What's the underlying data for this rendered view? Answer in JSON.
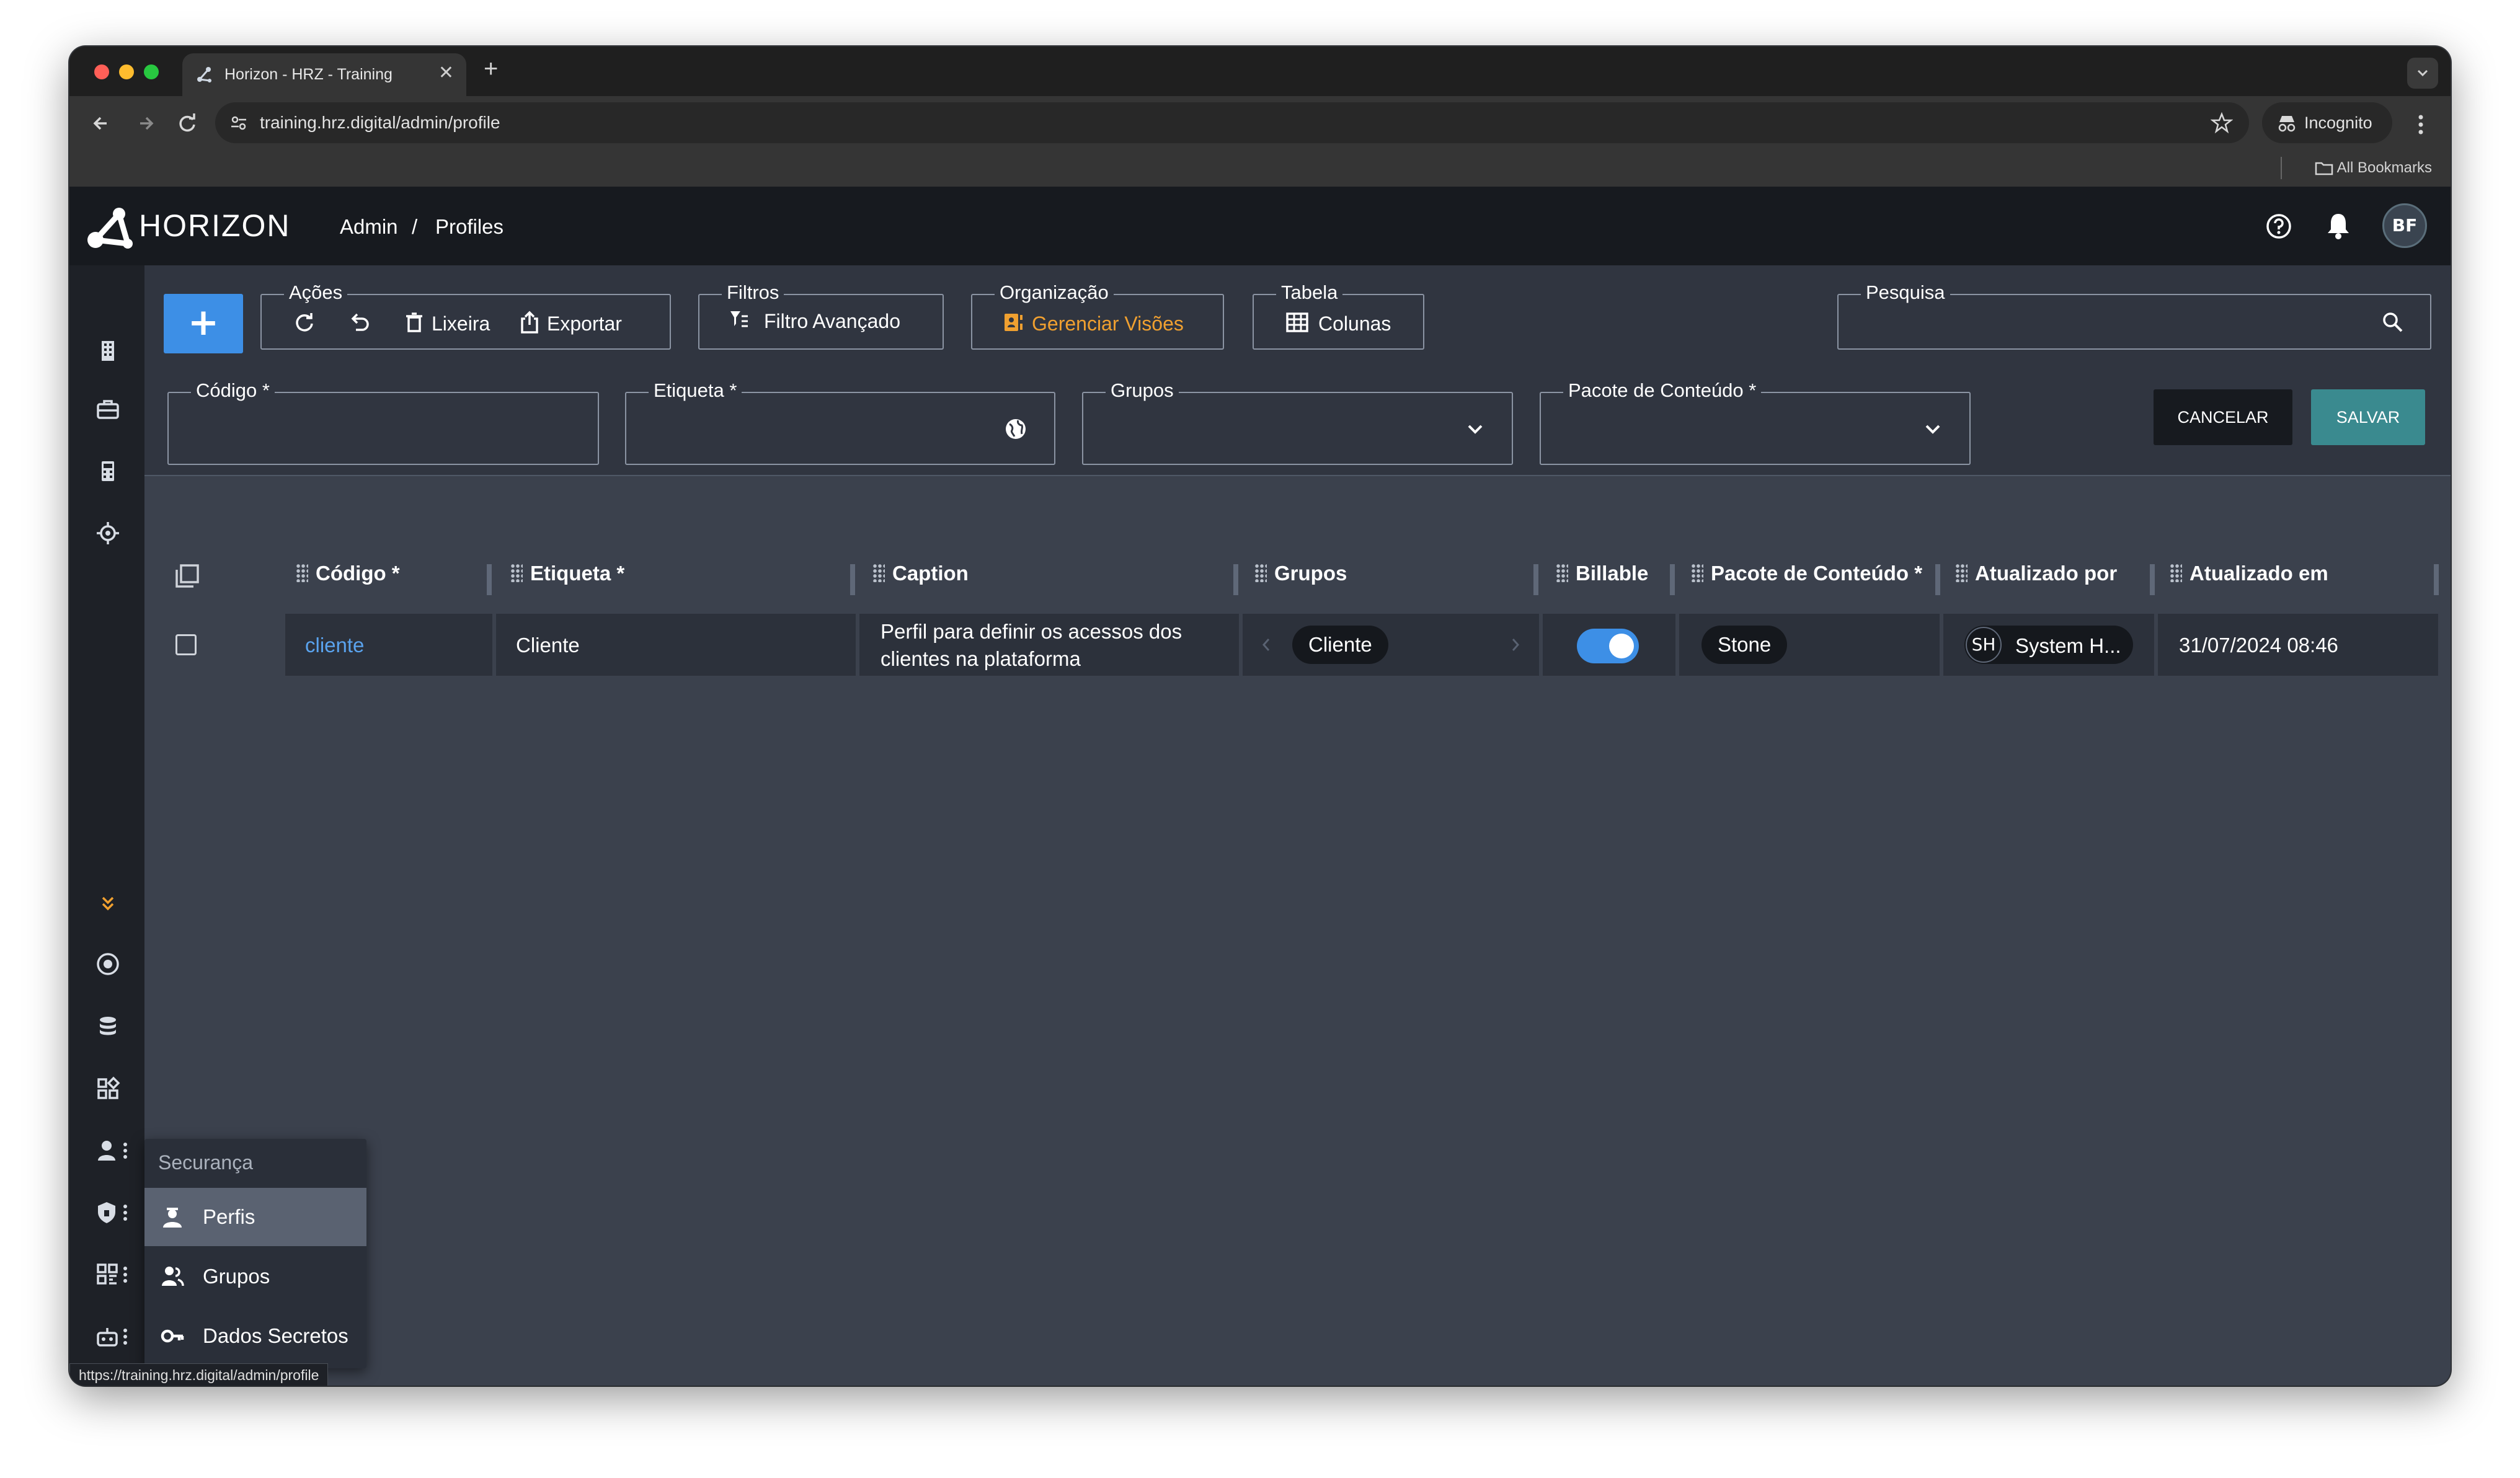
{
  "browser": {
    "tab_title": "Horizon - HRZ - Training",
    "tab_close": "✕",
    "new_tab": "+",
    "url": "training.hrz.digital/admin/profile",
    "incognito_label": "Incognito",
    "bookmarks_label": "All Bookmarks",
    "status_url": "https://training.hrz.digital/admin/profile"
  },
  "header": {
    "brand": "HORIZON",
    "breadcrumb": [
      "Admin",
      "/",
      "Profiles"
    ],
    "avatar_initials": "BF"
  },
  "toolbar": {
    "add_label": "+",
    "acoes": {
      "label": "Ações",
      "lixeira": "Lixeira",
      "exportar": "Exportar"
    },
    "filtros": {
      "label": "Filtros",
      "filtro_avancado": "Filtro Avançado"
    },
    "organizacao": {
      "label": "Organização",
      "gerenciar_visoes": "Gerenciar Visões"
    },
    "tabela": {
      "label": "Tabela",
      "colunas": "Colunas"
    },
    "pesquisa": {
      "label": "Pesquisa",
      "value": ""
    }
  },
  "form": {
    "codigo": {
      "label": "Código *",
      "value": ""
    },
    "etiqueta": {
      "label": "Etiqueta *",
      "value": ""
    },
    "grupos": {
      "label": "Grupos",
      "value": ""
    },
    "pacote": {
      "label": "Pacote de Conteúdo *",
      "value": ""
    },
    "cancel": "CANCELAR",
    "save": "SALVAR"
  },
  "table": {
    "columns": [
      "Código *",
      "Etiqueta *",
      "Caption",
      "Grupos",
      "Billable",
      "Pacote de Conteúdo *",
      "Atualizado por",
      "Atualizado em"
    ],
    "rows": [
      {
        "codigo": "cliente",
        "etiqueta": "Cliente",
        "caption_line1": "Perfil para definir os acessos dos",
        "caption_line2": "clientes na plataforma",
        "grupos": "Cliente",
        "billable": true,
        "pacote": "Stone",
        "atualizado_por_initials": "SH",
        "atualizado_por": "System H...",
        "atualizado_em": "31/07/2024 08:46"
      }
    ]
  },
  "security_menu": {
    "title": "Securança",
    "items": [
      "Perfis",
      "Grupos",
      "Dados Secretos"
    ]
  },
  "colors": {
    "accent": "#3d8fe6",
    "save": "#3a8a8f",
    "orange": "#f0a030",
    "link": "#5aa3ee"
  }
}
